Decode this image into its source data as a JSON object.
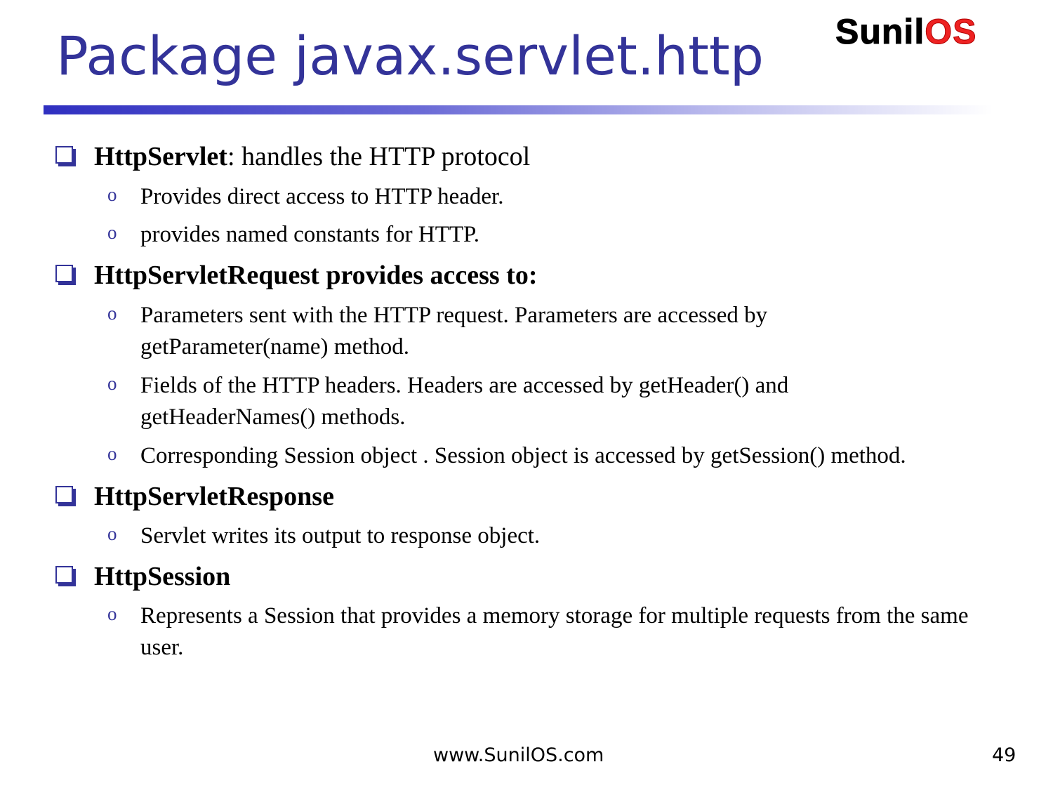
{
  "slide": {
    "title": "Package javax.servlet.http",
    "logo": {
      "part1": "Sunil",
      "part2": "OS"
    },
    "footer": "www.SunilOS.com",
    "page_number": "49",
    "colors": {
      "title": "#333399",
      "logo_accent": "#ee2222",
      "bullet": "#333399"
    }
  },
  "bullets": [
    {
      "bold": "HttpServlet",
      "rest": ": handles the HTTP protocol",
      "subs": [
        "Provides direct access to HTTP header.",
        "provides named constants for HTTP."
      ]
    },
    {
      "bold": "HttpServletRequest provides access to:",
      "rest": "",
      "subs": [
        "Parameters  sent with the HTTP request. Parameters are accessed by getParameter(name) method.",
        "Fields of the HTTP headers. Headers are accessed by getHeader() and getHeaderNames() methods.",
        "Corresponding Session object . Session object is accessed by getSession() method."
      ]
    },
    {
      "bold": "HttpServletResponse",
      "rest": "",
      "subs": [
        "Servlet writes its output to response object."
      ]
    },
    {
      "bold": "HttpSession",
      "rest": "",
      "subs": [
        "Represents a Session that provides a memory storage for multiple requests from the same user."
      ]
    }
  ]
}
